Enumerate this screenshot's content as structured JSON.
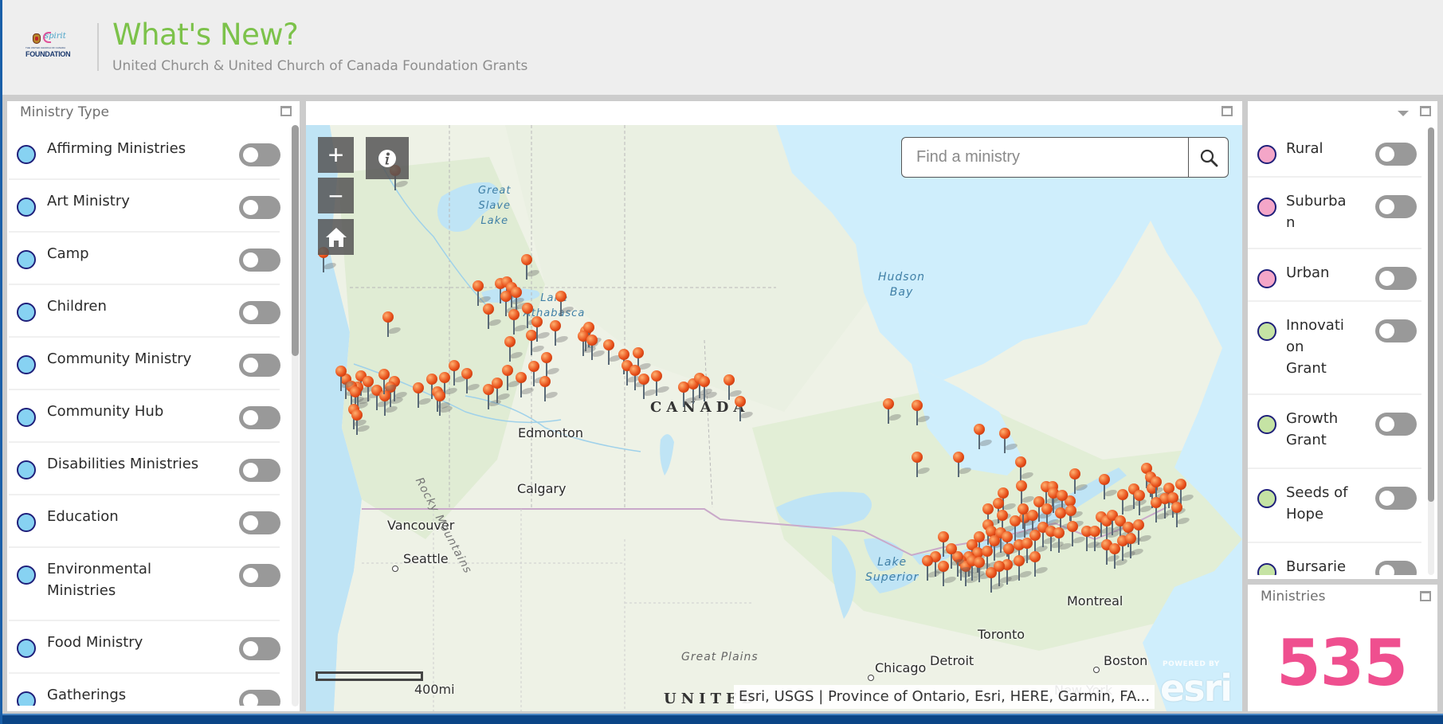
{
  "header": {
    "logo": {
      "top_text": "spirit",
      "small_text": "THE UNITED CHURCH OF CANADA",
      "main_text": "FOUNDATION"
    },
    "title": "What's New?",
    "subtitle": "United Church & United Church of Canada Foundation Grants"
  },
  "left_panel": {
    "title": "Ministry Type",
    "scroll_position": 0.0,
    "items": [
      {
        "label": "Affirming Ministries",
        "color": "#87d2f2",
        "enabled": false
      },
      {
        "label": "Art Ministry",
        "color": "#87d2f2",
        "enabled": false
      },
      {
        "label": "Camp",
        "color": "#87d2f2",
        "enabled": false
      },
      {
        "label": "Children",
        "color": "#87d2f2",
        "enabled": false
      },
      {
        "label": "Community Ministry",
        "color": "#87d2f2",
        "enabled": false
      },
      {
        "label": "Community Hub",
        "color": "#87d2f2",
        "enabled": false
      },
      {
        "label": "Disabilities Ministries",
        "color": "#87d2f2",
        "enabled": false
      },
      {
        "label": "Education",
        "color": "#87d2f2",
        "enabled": false
      },
      {
        "label": "Environmental Ministries",
        "label_lines": [
          "Environmental",
          "Ministries"
        ],
        "color": "#87d2f2",
        "enabled": false
      },
      {
        "label": "Food Ministry",
        "color": "#87d2f2",
        "enabled": false
      },
      {
        "label": "Gatherings",
        "color": "#87d2f2",
        "enabled": false
      }
    ]
  },
  "map": {
    "search": {
      "placeholder": "Find a ministry",
      "value": ""
    },
    "controls": {
      "zoom_in": "+",
      "zoom_out": "−"
    },
    "labels": {
      "great_slave_lake": [
        "Great",
        "Slave",
        "Lake"
      ],
      "lake_athabasca": [
        "Lake",
        "Athabasca"
      ],
      "hudson_bay": [
        "Hudson",
        "Bay"
      ],
      "canada": "CANADA",
      "edmonton": "Edmonton",
      "calgary": "Calgary",
      "vancouver": "Vancouver",
      "seattle": "Seattle",
      "rocky_mountains": "Rocky Mountains",
      "lake_superior": [
        "Lake",
        "Superior"
      ],
      "montreal": "Montreal",
      "toronto": "Toronto",
      "detroit": "Detroit",
      "chicago": "Chicago",
      "boston": "Boston",
      "great_plains": "Great Plains",
      "united_states": "UNITED",
      "new_york": "New York"
    },
    "scale_label": "400mi",
    "attribution": "Esri, USGS | Province of Ontario, Esri, HERE, Garmin, FA...",
    "esri_powered_by": "POWERED BY",
    "esri_word": "esri",
    "pin_color": "#e8501a"
  },
  "right_panel": {
    "scroll_position": 0.0,
    "items": [
      {
        "label": "Rural",
        "label_lines": [
          "Rural"
        ],
        "color": "#f4a6c8",
        "enabled": false
      },
      {
        "label": "Suburban",
        "label_lines": [
          "Suburba",
          "n"
        ],
        "color": "#f4a6c8",
        "enabled": false
      },
      {
        "label": "Urban",
        "label_lines": [
          "Urban"
        ],
        "color": "#f4a6c8",
        "enabled": false
      },
      {
        "label": "Innovation Grant",
        "label_lines": [
          "Innovati",
          "on",
          "Grant"
        ],
        "color": "#c5e3a4",
        "enabled": false
      },
      {
        "label": "Growth Grant",
        "label_lines": [
          "Growth",
          "Grant"
        ],
        "color": "#c5e3a4",
        "enabled": false
      },
      {
        "label": "Seeds of Hope",
        "label_lines": [
          "Seeds of",
          "Hope"
        ],
        "color": "#c5e3a4",
        "enabled": false
      },
      {
        "label": "Bursaries",
        "label_lines": [
          "Bursarie"
        ],
        "color": "#c5e3a4",
        "enabled": false
      }
    ]
  },
  "count_panel": {
    "title": "Ministries",
    "value": "535",
    "value_color": "#ef4f8f"
  }
}
